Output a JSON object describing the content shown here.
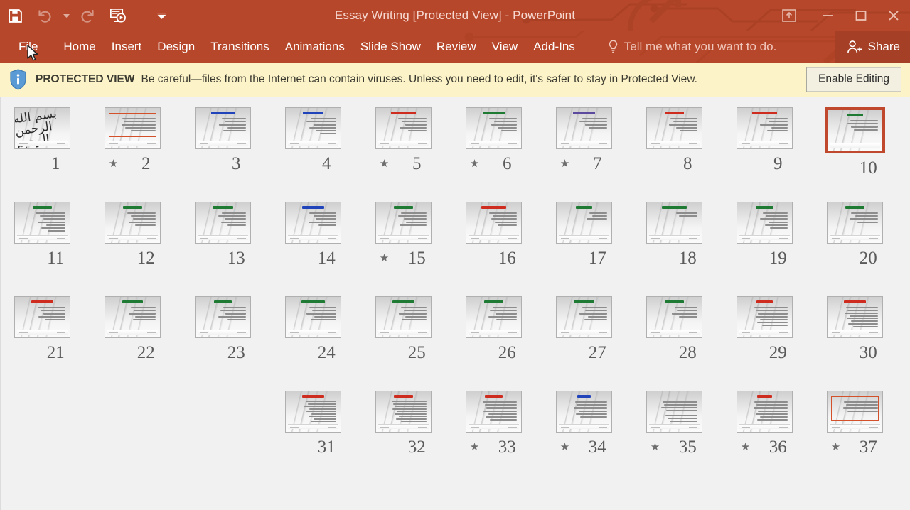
{
  "window": {
    "title": "Essay Writing [Protected View] - PowerPoint",
    "accent_color": "#b7472a",
    "controls": [
      {
        "name": "ribbon-display-options",
        "glyph": "ribbon"
      },
      {
        "name": "minimize",
        "glyph": "minimize"
      },
      {
        "name": "maximize",
        "glyph": "maximize"
      },
      {
        "name": "close",
        "glyph": "close"
      }
    ]
  },
  "quick_access": [
    {
      "name": "save",
      "label": "Save",
      "enabled": true
    },
    {
      "name": "undo",
      "label": "Undo",
      "enabled": false
    },
    {
      "name": "undo-dropdown",
      "label": "Undo options",
      "enabled": false
    },
    {
      "name": "redo",
      "label": "Redo",
      "enabled": false
    },
    {
      "name": "start-from-beginning",
      "label": "Start From Beginning",
      "enabled": true
    },
    {
      "name": "customize-quick-access-toolbar",
      "label": "Customize Quick Access Toolbar",
      "enabled": true
    }
  ],
  "ribbon": {
    "tabs": [
      {
        "label": "File",
        "active": false
      },
      {
        "label": "Home",
        "active": false
      },
      {
        "label": "Insert",
        "active": false
      },
      {
        "label": "Design",
        "active": false
      },
      {
        "label": "Transitions",
        "active": false
      },
      {
        "label": "Animations",
        "active": false
      },
      {
        "label": "Slide Show",
        "active": false
      },
      {
        "label": "Review",
        "active": false
      },
      {
        "label": "View",
        "active": false
      },
      {
        "label": "Add-Ins",
        "active": false
      }
    ],
    "tell_me": "Tell me what you want to do.",
    "share": "Share"
  },
  "protected_view": {
    "label": "PROTECTED VIEW",
    "message": "Be careful—files from the Internet can contain viruses. Unless you need to edit, it's safer to stay in Protected View.",
    "button": "Enable Editing",
    "background": "#fdf3c8"
  },
  "slide_sorter": {
    "selected_slide": 10,
    "selection_color": "#c0482c",
    "rows": [
      {
        "slides": [
          {
            "number": 10,
            "star": false,
            "selected": true,
            "title_color": "#1f7a34",
            "title_w": 34,
            "lines": [
              60,
              66,
              58,
              52
            ],
            "redbox": false
          },
          {
            "number": 9,
            "star": false,
            "selected": false,
            "title_color": "#cf2c20",
            "title_w": 52,
            "lines": [
              48,
              42,
              60,
              36,
              44
            ],
            "redbox": false
          },
          {
            "number": 8,
            "star": false,
            "selected": false,
            "title_color": "#cf2c20",
            "title_w": 40,
            "lines": [
              58,
              52,
              62,
              46,
              38
            ],
            "redbox": false
          },
          {
            "number": 7,
            "star": true,
            "selected": false,
            "title_color": "#5b4a9e",
            "title_w": 46,
            "lines": [
              54,
              60,
              48,
              40
            ],
            "redbox": false
          },
          {
            "number": 6,
            "star": true,
            "selected": false,
            "title_color": "#1f7a34",
            "title_w": 44,
            "lines": [
              60,
              50,
              56,
              42,
              34
            ],
            "redbox": false
          },
          {
            "number": 5,
            "star": true,
            "selected": false,
            "title_color": "#cf2c20",
            "title_w": 50,
            "lines": [
              62,
              54,
              46,
              58,
              40
            ],
            "redbox": false
          },
          {
            "number": 4,
            "star": false,
            "selected": false,
            "title_color": "#2244bb",
            "title_w": 42,
            "lines": [
              56,
              64,
              50,
              58,
              44,
              36
            ],
            "redbox": false
          },
          {
            "number": 3,
            "star": false,
            "selected": false,
            "title_color": "#2244bb",
            "title_w": 48,
            "lines": [
              52,
              46,
              58,
              40,
              50
            ],
            "redbox": false
          },
          {
            "number": 2,
            "star": true,
            "selected": false,
            "title_color": "#cf2c20",
            "title_w": 0,
            "lines": [
              72,
              70,
              74,
              66,
              54
            ],
            "redbox": true
          },
          {
            "number": 1,
            "star": false,
            "selected": false,
            "title_color": "",
            "title_w": 0,
            "lines": [],
            "calligraphy": "بسم الله الرحمن الرحيم",
            "redbox": false
          }
        ]
      },
      {
        "slides": [
          {
            "number": 20,
            "star": false,
            "selected": false,
            "title_color": "#1f7a34",
            "title_w": 40,
            "lines": [
              58,
              50,
              62,
              44
            ],
            "redbox": false
          },
          {
            "number": 19,
            "star": false,
            "selected": false,
            "title_color": "#1f7a34",
            "title_w": 36,
            "lines": [
              54,
              48,
              60,
              42,
              50,
              38
            ],
            "redbox": false
          },
          {
            "number": 18,
            "star": false,
            "selected": false,
            "title_color": "#1f7a34",
            "title_w": 52,
            "lines": [
              46,
              40
            ],
            "redbox": false
          },
          {
            "number": 17,
            "star": false,
            "selected": false,
            "title_color": "#1f7a34",
            "title_w": 34,
            "lines": [
              38,
              32,
              44
            ],
            "redbox": false
          },
          {
            "number": 16,
            "star": false,
            "selected": false,
            "title_color": "#cf2c20",
            "title_w": 50,
            "lines": [
              60,
              52,
              56,
              48,
              42
            ],
            "redbox": false
          },
          {
            "number": 15,
            "star": true,
            "selected": false,
            "title_color": "#1f7a34",
            "title_w": 38,
            "lines": [
              56,
              62,
              50,
              44,
              58
            ],
            "redbox": false
          },
          {
            "number": 14,
            "star": false,
            "selected": false,
            "title_color": "#2244bb",
            "title_w": 44,
            "lines": [
              58,
              50,
              44,
              60,
              38
            ],
            "redbox": false
          },
          {
            "number": 13,
            "star": false,
            "selected": false,
            "title_color": "#1f7a34",
            "title_w": 42,
            "lines": [
              52,
              60,
              46,
              54,
              40
            ],
            "redbox": false
          },
          {
            "number": 12,
            "star": false,
            "selected": false,
            "title_color": "#1f7a34",
            "title_w": 38,
            "lines": [
              62,
              54,
              50,
              58,
              44
            ],
            "redbox": false
          },
          {
            "number": 11,
            "star": false,
            "selected": false,
            "title_color": "#1f7a34",
            "title_w": 40,
            "lines": [
              64,
              56,
              48,
              60,
              42,
              52,
              38
            ],
            "redbox": false
          }
        ]
      },
      {
        "slides": [
          {
            "number": 30,
            "star": false,
            "selected": false,
            "title_color": "#cf2c20",
            "title_w": 46,
            "lines": [
              70,
              66,
              72,
              62,
              68,
              58,
              64,
              54
            ],
            "redbox": false
          },
          {
            "number": 29,
            "star": false,
            "selected": false,
            "title_color": "#cf2c20",
            "title_w": 34,
            "lines": [
              72,
              68,
              64,
              70,
              60,
              66,
              56
            ],
            "redbox": false
          },
          {
            "number": 28,
            "star": false,
            "selected": false,
            "title_color": "#1f7a34",
            "title_w": 38,
            "lines": [
              50,
              44,
              56,
              40
            ],
            "redbox": false
          },
          {
            "number": 27,
            "star": false,
            "selected": false,
            "title_color": "#1f7a34",
            "title_w": 42,
            "lines": [
              54,
              48,
              60,
              42,
              50
            ],
            "redbox": false
          },
          {
            "number": 26,
            "star": false,
            "selected": false,
            "title_color": "#1f7a34",
            "title_w": 40,
            "lines": [
              52,
              58,
              46,
              62,
              44
            ],
            "redbox": false
          },
          {
            "number": 25,
            "star": false,
            "selected": false,
            "title_color": "#1f7a34",
            "title_w": 44,
            "lines": [
              56,
              50,
              60,
              46,
              54
            ],
            "redbox": false
          },
          {
            "number": 24,
            "star": false,
            "selected": false,
            "title_color": "#1f7a34",
            "title_w": 48,
            "lines": [
              58,
              52,
              64,
              48,
              56
            ],
            "redbox": false
          },
          {
            "number": 23,
            "star": false,
            "selected": false,
            "title_color": "#1f7a34",
            "title_w": 36,
            "lines": [
              50,
              56,
              44,
              60,
              40
            ],
            "redbox": false
          },
          {
            "number": 22,
            "star": false,
            "selected": false,
            "title_color": "#1f7a34",
            "title_w": 42,
            "lines": [
              54,
              48,
              58,
              44,
              50
            ],
            "redbox": false
          },
          {
            "number": 21,
            "star": false,
            "selected": false,
            "title_color": "#cf2c20",
            "title_w": 46,
            "lines": [
              60,
              54,
              48,
              58,
              44
            ],
            "redbox": false
          }
        ]
      },
      {
        "slides": [
          {
            "number": 37,
            "star": true,
            "selected": false,
            "title_color": "",
            "title_w": 0,
            "lines": [
              74,
              70,
              76,
              66
            ],
            "redbox": true
          },
          {
            "number": 36,
            "star": true,
            "selected": false,
            "title_color": "#cf2c20",
            "title_w": 30,
            "lines": [
              72,
              68,
              74,
              64,
              70,
              60,
              66
            ],
            "redbox": false
          },
          {
            "number": 35,
            "star": true,
            "selected": false,
            "title_color": "",
            "title_w": 0,
            "lines": [
              76,
              72,
              78,
              68,
              74,
              70,
              64,
              60
            ],
            "redbox": false
          },
          {
            "number": 34,
            "star": true,
            "selected": false,
            "title_color": "#2244bb",
            "title_w": 28,
            "lines": [
              70,
              66,
              72,
              62,
              68,
              58
            ],
            "redbox": false
          },
          {
            "number": 33,
            "star": true,
            "selected": false,
            "title_color": "#cf2c20",
            "title_w": 36,
            "lines": [
              74,
              70,
              66,
              72,
              62,
              68,
              58
            ],
            "redbox": false
          },
          {
            "number": 32,
            "star": false,
            "selected": false,
            "title_color": "#cf2c20",
            "title_w": 40,
            "lines": [
              76,
              72,
              68,
              74,
              64,
              70,
              60,
              66,
              56
            ],
            "redbox": false
          },
          {
            "number": 31,
            "star": false,
            "selected": false,
            "title_color": "#cf2c20",
            "title_w": 44,
            "lines": [
              66,
              62,
              70,
              58,
              64,
              54,
              60,
              50,
              56
            ],
            "redbox": false
          }
        ]
      }
    ]
  }
}
